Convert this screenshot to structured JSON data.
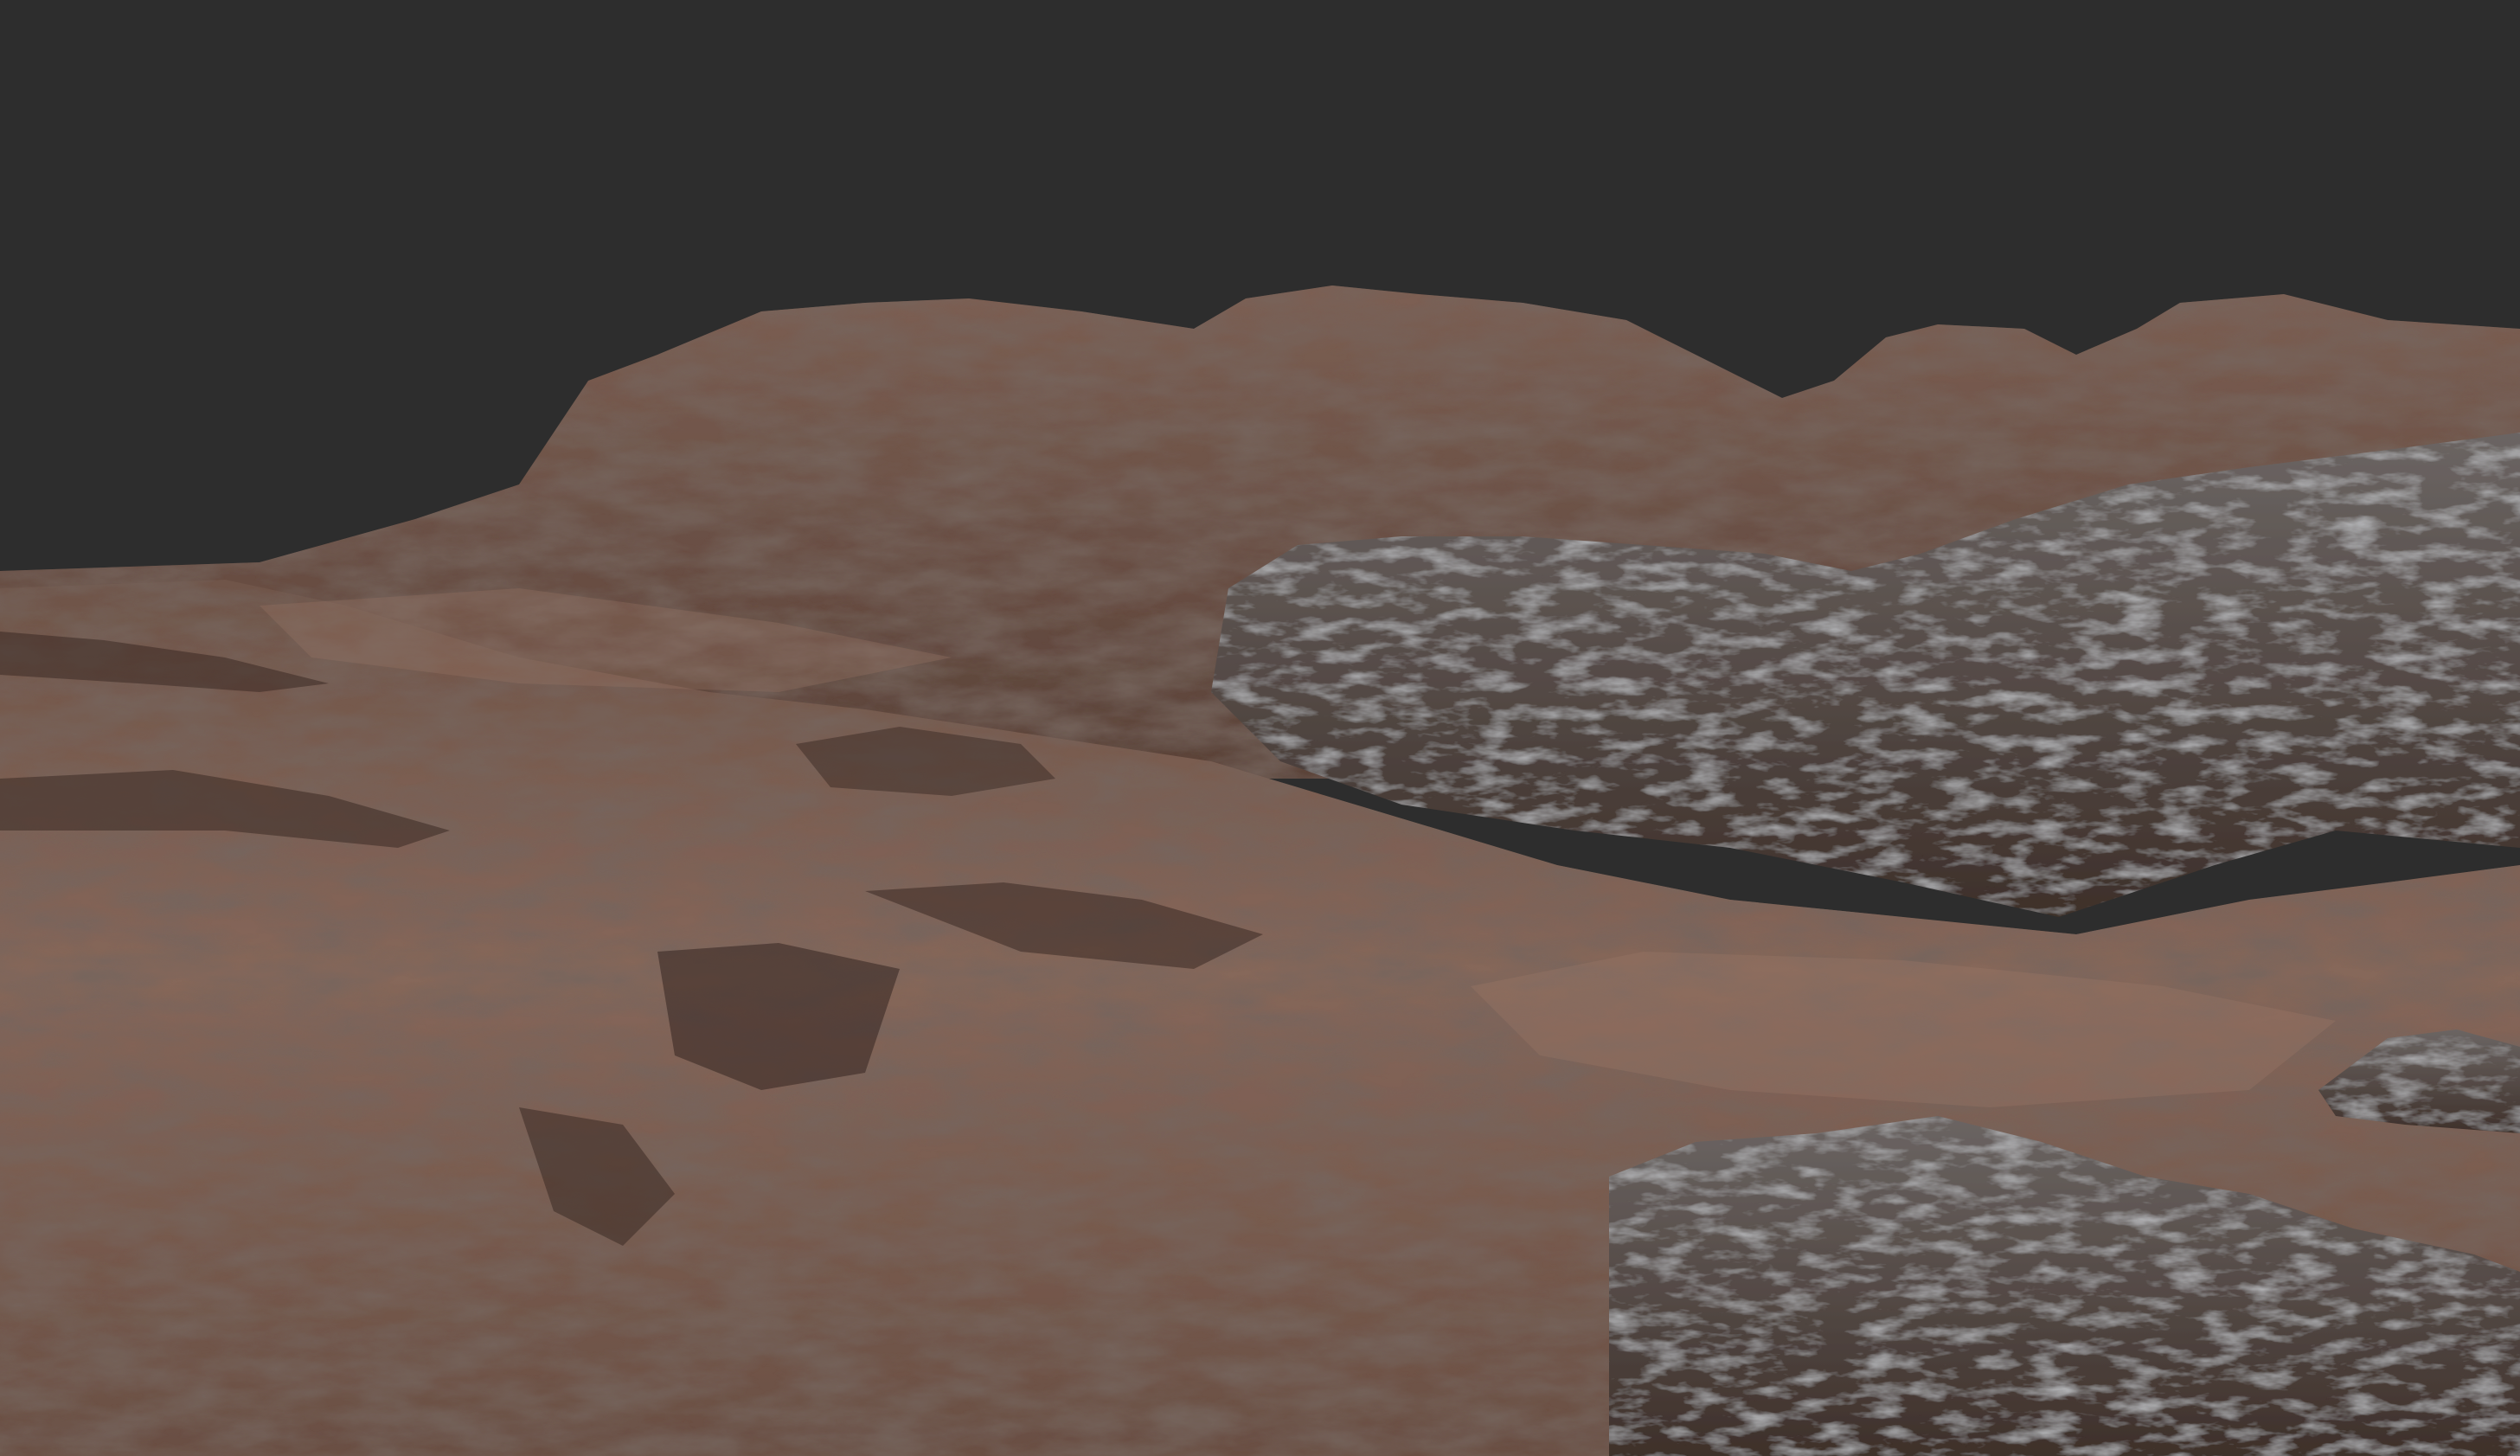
{
  "scene": {
    "subject": "terrain-render",
    "colors": {
      "background": "#2d2d2d",
      "terrain_light": "#8a6a5a",
      "terrain_mid": "#6e5246",
      "terrain_shadow": "#3a2a24",
      "rock_highlight": "#8d8e93",
      "rock_dark": "#2b211d"
    }
  }
}
